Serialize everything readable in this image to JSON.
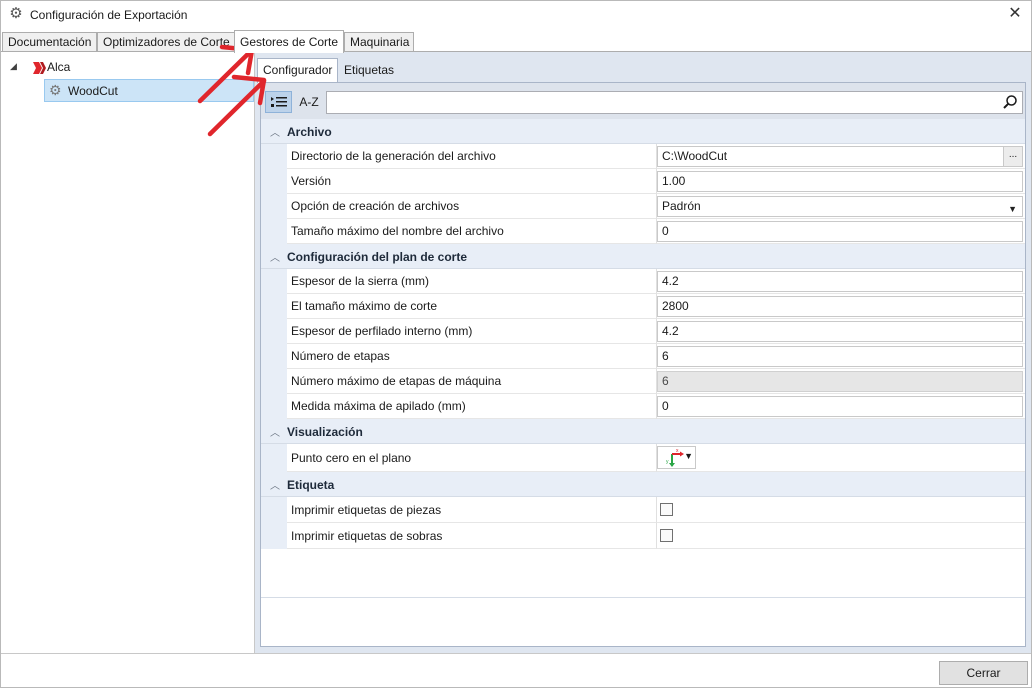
{
  "window": {
    "title": "Configuración de Exportación",
    "close_glyph": "✕"
  },
  "top_tabs": [
    {
      "label": "Documentación",
      "active": false
    },
    {
      "label": "Optimizadores de Corte",
      "active": false
    },
    {
      "label": "Gestores de Corte",
      "active": true
    },
    {
      "label": "Maquinaria",
      "active": false
    }
  ],
  "tree": {
    "root": {
      "label": "Alca",
      "expander": "◢"
    },
    "child": {
      "label": "WoodCut"
    }
  },
  "inner_tabs": [
    {
      "label": "Configurador",
      "active": true
    },
    {
      "label": "Etiquetas",
      "active": false
    }
  ],
  "toolbar": {
    "categorized_glyph": "☰",
    "alphabetical_label": "A-Z",
    "search_placeholder": ""
  },
  "categories": {
    "archivo": {
      "label": "Archivo",
      "rows": [
        {
          "name": "Directorio de la generación del archivo",
          "value": "C:\\WoodCut"
        },
        {
          "name": "Versión",
          "value": "1.00"
        },
        {
          "name": "Opción de creación de archivos",
          "value": "Padrón"
        },
        {
          "name": "Tamaño máximo del nombre del archivo",
          "value": "0"
        }
      ]
    },
    "plan": {
      "label": "Configuración del plan de corte",
      "rows": [
        {
          "name": "Espesor de la sierra (mm)",
          "value": "4.2"
        },
        {
          "name": "El tamaño máximo de corte",
          "value": "2800"
        },
        {
          "name": "Espesor de perfilado interno (mm)",
          "value": "4.2"
        },
        {
          "name": "Número de etapas",
          "value": "6"
        },
        {
          "name": "Número máximo de etapas de máquina",
          "value": "6"
        },
        {
          "name": "Medida máxima de apilado (mm)",
          "value": "0"
        }
      ]
    },
    "visualizacion": {
      "label": "Visualización",
      "rows": [
        {
          "name": "Punto cero en el plano"
        }
      ]
    },
    "etiqueta": {
      "label": "Etiqueta",
      "rows": [
        {
          "name": "Imprimir etiquetas de piezas",
          "checked": false
        },
        {
          "name": "Imprimir etiquetas de sobras",
          "checked": false
        }
      ]
    }
  },
  "ellipsis_label": "...",
  "footer": {
    "close_label": "Cerrar"
  },
  "colors": {
    "accent": "#cce4f7",
    "arrow": "#e0262c"
  }
}
